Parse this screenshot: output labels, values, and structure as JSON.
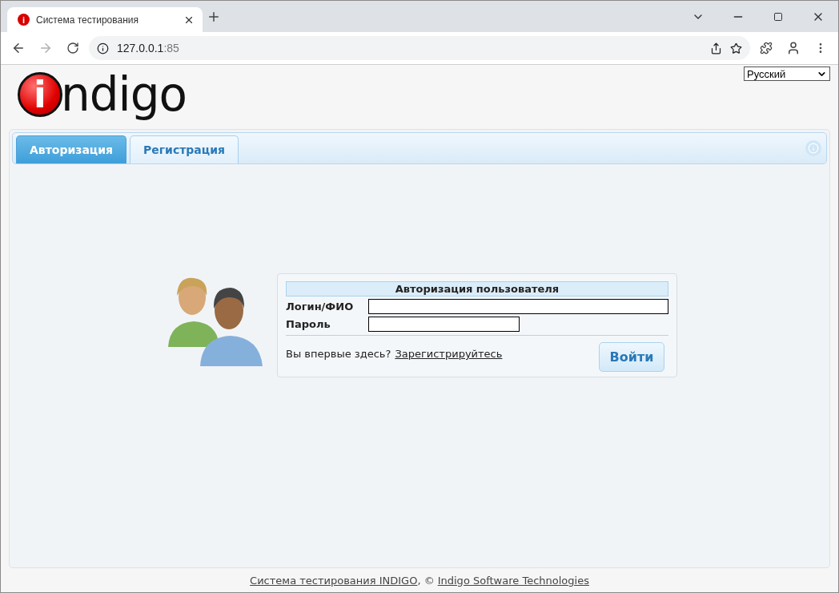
{
  "browser": {
    "favicon": "i",
    "tab_title": "Система тестирования",
    "url_host": "127.0.0.1",
    "url_port": ":85"
  },
  "logo": {
    "mark": "i",
    "text": "ndigo"
  },
  "language": {
    "value": "Русский"
  },
  "tabs": [
    {
      "label": "Авторизация",
      "selected": true
    },
    {
      "label": "Регистрация",
      "selected": false
    }
  ],
  "login": {
    "title": "Авторизация пользователя",
    "fields": [
      {
        "label": "Логин/ФИО",
        "kind": "wide"
      },
      {
        "label": "Пароль",
        "kind": "short"
      }
    ],
    "prompt": "Вы впервые здесь?",
    "register_link": "Зарегистрируйтесь",
    "submit": "Войти"
  },
  "footer": {
    "link_1": "Система тестирования INDIGO",
    "separator": ", ©",
    "link_2": "Indigo Software Technologies"
  }
}
